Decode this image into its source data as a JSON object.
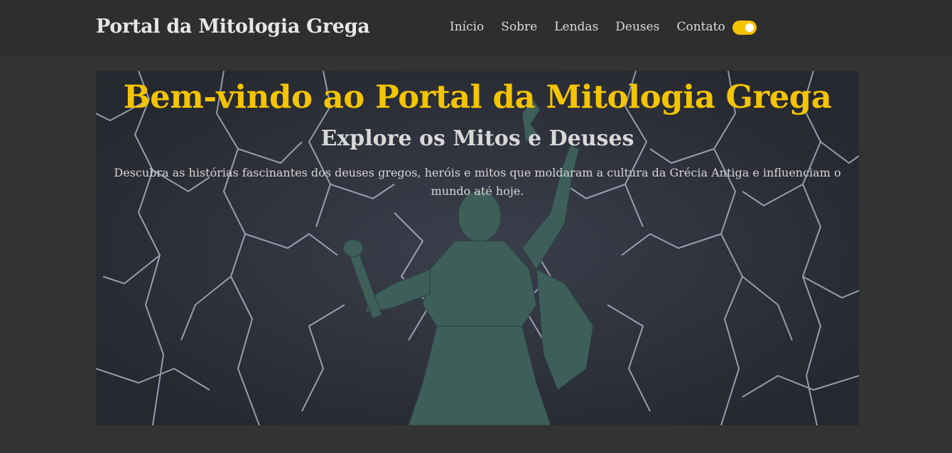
{
  "header": {
    "brand": "Portal da Mitologia Grega",
    "nav": [
      "Início",
      "Sobre",
      "Lendas",
      "Deuses",
      "Contato"
    ],
    "theme_toggle": {
      "state": "on",
      "color": "#f5c400"
    }
  },
  "hero": {
    "title": "Bem-vindo ao Portal da Mitologia Grega",
    "subtitle": "Explore os Mitos e Deuses",
    "description": "Descubra as histórias fascinantes dos deuses gregos, heróis e mitos que moldaram a cultura da Grécia Antiga e influenciam o mundo até hoje.",
    "background": "zeus-statue-with-lightning-image"
  },
  "colors": {
    "page_background": "#333333",
    "navbar": "#2e2e2e",
    "accent": "#f5c400",
    "text": "#dcdcdc"
  }
}
